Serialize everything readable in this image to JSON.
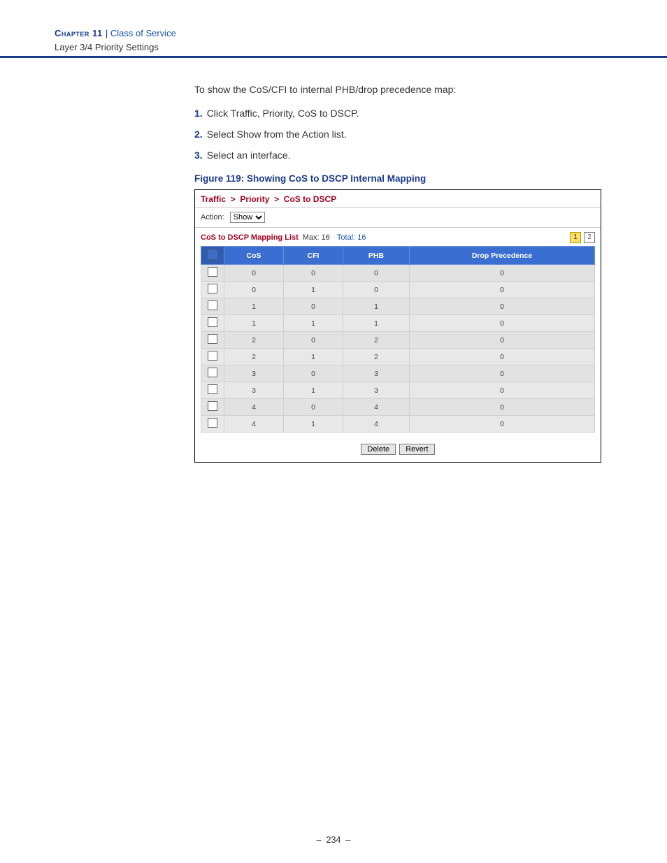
{
  "header": {
    "chapter_word": "Chapter",
    "chapter_num": "11",
    "separator": "|",
    "chapter_title": "Class of Service",
    "subtitle": "Layer 3/4 Priority Settings"
  },
  "intro": "To show the CoS/CFI to internal PHB/drop precedence map:",
  "steps": [
    "Click Traffic, Priority, CoS to DSCP.",
    "Select Show from the Action list.",
    "Select an interface."
  ],
  "figure_caption": "Figure 119:  Showing CoS to DSCP Internal Mapping",
  "app": {
    "breadcrumb": [
      "Traffic",
      "Priority",
      "CoS to DSCP"
    ],
    "action_label": "Action:",
    "action_value": "Show",
    "list_title": "CoS to DSCP Mapping List",
    "max_label": "Max: 16",
    "total_label": "Total: 16",
    "pages": [
      "1",
      "2"
    ],
    "current_page": "1",
    "columns": [
      "CoS",
      "CFI",
      "PHB",
      "Drop Precedence"
    ],
    "rows": [
      {
        "cos": "0",
        "cfi": "0",
        "phb": "0",
        "dp": "0"
      },
      {
        "cos": "0",
        "cfi": "1",
        "phb": "0",
        "dp": "0"
      },
      {
        "cos": "1",
        "cfi": "0",
        "phb": "1",
        "dp": "0"
      },
      {
        "cos": "1",
        "cfi": "1",
        "phb": "1",
        "dp": "0"
      },
      {
        "cos": "2",
        "cfi": "0",
        "phb": "2",
        "dp": "0"
      },
      {
        "cos": "2",
        "cfi": "1",
        "phb": "2",
        "dp": "0"
      },
      {
        "cos": "3",
        "cfi": "0",
        "phb": "3",
        "dp": "0"
      },
      {
        "cos": "3",
        "cfi": "1",
        "phb": "3",
        "dp": "0"
      },
      {
        "cos": "4",
        "cfi": "0",
        "phb": "4",
        "dp": "0"
      },
      {
        "cos": "4",
        "cfi": "1",
        "phb": "4",
        "dp": "0"
      }
    ],
    "buttons": {
      "delete": "Delete",
      "revert": "Revert"
    }
  },
  "footer": {
    "dash": "–",
    "page": "234"
  }
}
